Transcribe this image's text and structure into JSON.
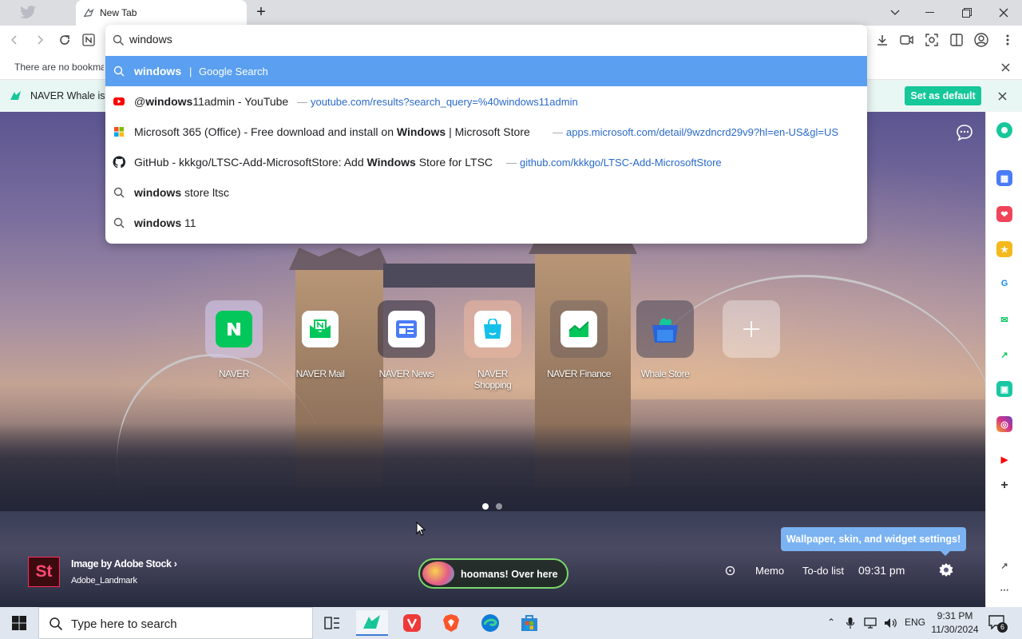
{
  "browser": {
    "tab_title": "New Tab",
    "bookmark_bar_text": "There are no bookmarks",
    "infobar_text": "NAVER Whale is",
    "set_default_label": "Set as default"
  },
  "omnibox": {
    "query": "windows",
    "suggestions": [
      {
        "icon": "search-icon",
        "bold": "windows",
        "rest": "",
        "separator": "|",
        "extra": "Google Search",
        "selected": true
      },
      {
        "icon": "youtube-icon",
        "prefix": "@",
        "bold": "windows",
        "rest": "11admin - YouTube",
        "separator": "—",
        "url": "youtube.com/results?search_query=%40windows11admin"
      },
      {
        "icon": "microsoft-store-icon",
        "prefix": "Microsoft 365 (Office) - Free download and install on ",
        "bold": "Windows",
        "rest": " | Microsoft Store",
        "separator": "—",
        "url": "apps.microsoft.com/detail/9wzdncrd29v9?hl=en-US&gl=US"
      },
      {
        "icon": "github-icon",
        "prefix": "GitHub - kkkgo/LTSC-Add-MicrosoftStore: Add ",
        "bold": "Windows",
        "rest": " Store for LTSC",
        "separator": "—",
        "url": "github.com/kkkgo/LTSC-Add-MicrosoftStore"
      },
      {
        "icon": "search-icon",
        "bold": "windows",
        "rest": " store ltsc"
      },
      {
        "icon": "search-icon",
        "bold": "windows",
        "rest": " 11"
      }
    ]
  },
  "speed_dial": [
    {
      "label": "NAVER",
      "icon": "naver-icon",
      "color": "#03c75a"
    },
    {
      "label": "NAVER Mail",
      "icon": "naver-mail-icon",
      "color": "#03c75a"
    },
    {
      "label": "NAVER News",
      "icon": "naver-news-icon",
      "color": "#4a7bf7"
    },
    {
      "label": "NAVER Shopping",
      "icon": "naver-shopping-icon",
      "color": "#13c1e8"
    },
    {
      "label": "NAVER Finance",
      "icon": "naver-finance-icon",
      "color": "#03c75a"
    },
    {
      "label": "Whale Store",
      "icon": "whale-store-icon",
      "color": "#2a64d9"
    }
  ],
  "wallpaper": {
    "credit_title": "Image by Adobe Stock",
    "credit_sub": "Adobe_Landmark",
    "hoomans_label": "hoomans! Over here"
  },
  "widgets": {
    "memo": "Memo",
    "todo": "To-do list",
    "clock": "09:31 pm",
    "settings_tooltip": "Wallpaper, skin, and widget settings!"
  },
  "taskbar": {
    "search_placeholder": "Type here to search",
    "lang": "ENG",
    "time": "9:31 PM",
    "date": "11/30/2024",
    "notification_count": "6"
  },
  "colors": {
    "accent": "#16c79a",
    "selected_suggestion": "#5a9ff0",
    "url": "#2a6ac8"
  }
}
